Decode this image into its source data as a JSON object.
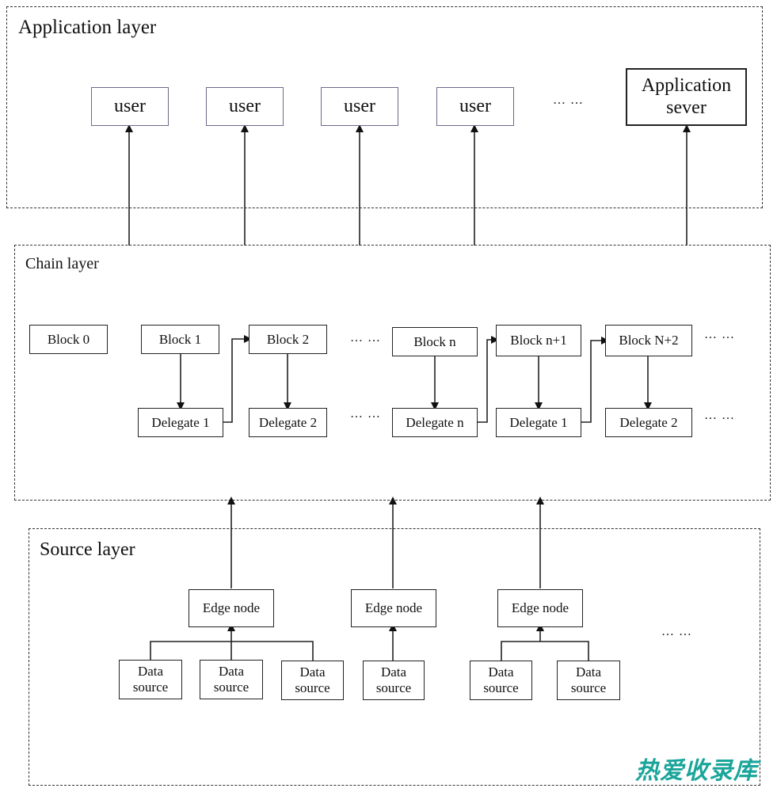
{
  "application_layer": {
    "title": "Application layer",
    "users": [
      "user",
      "user",
      "user",
      "user"
    ],
    "ellipsis": "… …",
    "server": [
      "Application",
      "sever"
    ]
  },
  "chain_layer": {
    "title": "Chain layer",
    "blocks": [
      "Block 0",
      "Block 1",
      "Block 2",
      "Block n",
      "Block n+1",
      "Block N+2"
    ],
    "delegates": [
      "Delegate 1",
      "Delegate 2",
      "Delegate n",
      "Delegate 1",
      "Delegate 2"
    ],
    "ellipsis": "… …"
  },
  "source_layer": {
    "title": "Source layer",
    "edge_nodes": [
      "Edge node",
      "Edge node",
      "Edge node"
    ],
    "data_source": [
      "Data",
      "source"
    ],
    "ellipsis": "… …"
  },
  "watermark": "热爱收录库",
  "colors": {
    "line": "#222222",
    "dash": "#333333",
    "watermark": "#1aa59a"
  }
}
